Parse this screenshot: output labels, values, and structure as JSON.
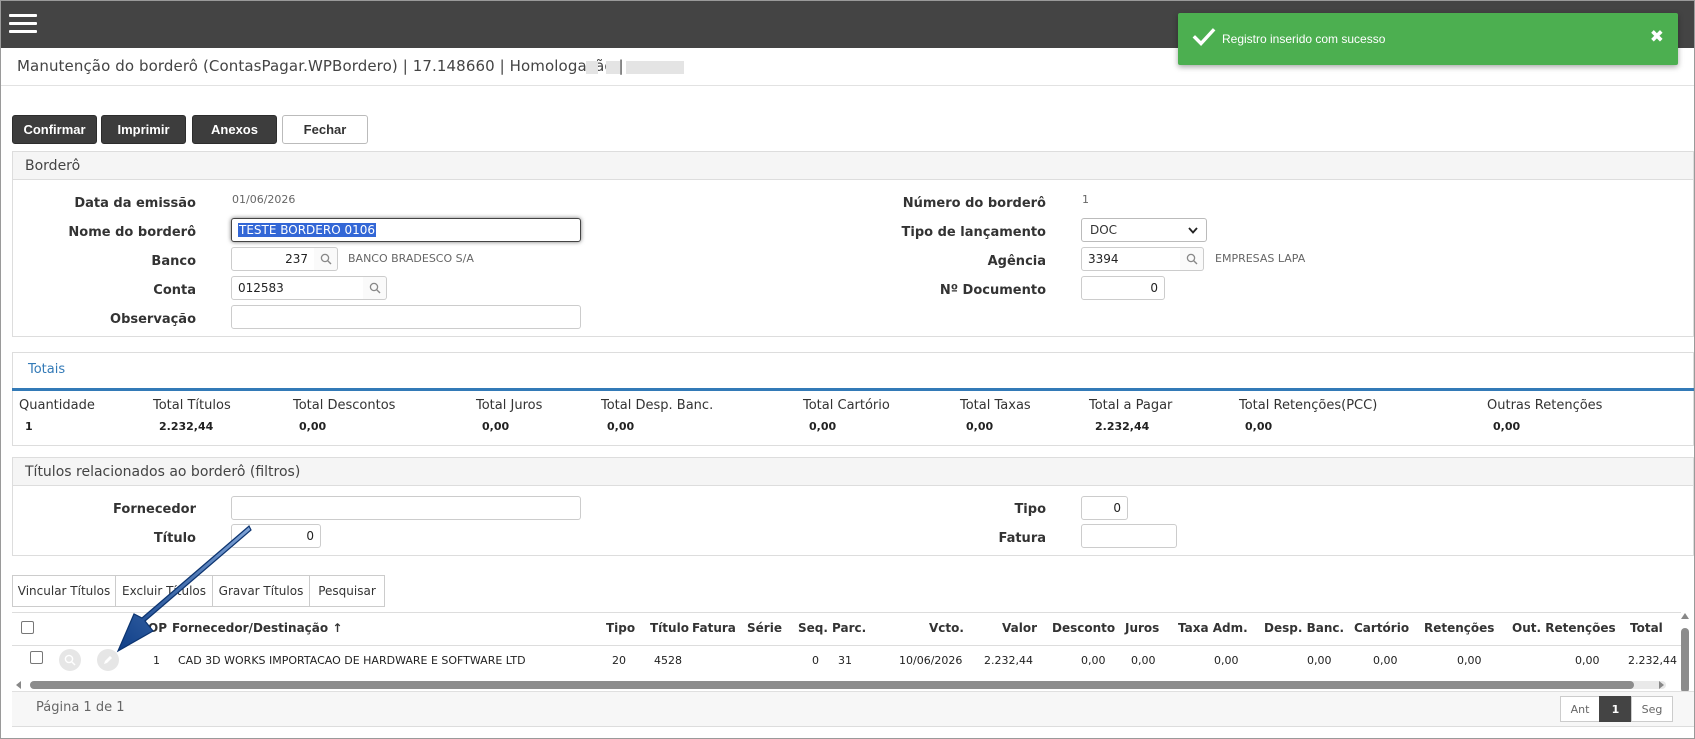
{
  "app": {
    "page_title": "Manutenção do borderô (ContasPagar.WPBordero) | 17.148660 | Homologação |"
  },
  "toast": {
    "message": "Registro inserido com sucesso",
    "color": "#4caf50",
    "icon": "check-icon",
    "close_icon": "close-icon"
  },
  "toolbar": {
    "confirm": "Confirmar",
    "print": "Imprimir",
    "attachments": "Anexos",
    "close": "Fechar"
  },
  "bordero": {
    "title": "Borderô",
    "emission_date_label": "Data da emissão",
    "emission_date": "01/06/2026",
    "name_label": "Nome do borderô",
    "name": "TESTE BORDERO 0106",
    "bank_label": "Banco",
    "bank_code": "237",
    "bank_name": "BANCO BRADESCO S/A",
    "account_label": "Conta",
    "account": "012583",
    "notes_label": "Observação",
    "notes": "",
    "number_label": "Número do borderô",
    "number": "1",
    "entry_type_label": "Tipo de lançamento",
    "entry_type": "DOC",
    "agency_label": "Agência",
    "agency": "3394",
    "agency_name": "EMPRESAS LAPA",
    "doc_number_label": "Nº Documento",
    "doc_number": "0"
  },
  "totals": {
    "tab": "Totais",
    "accent": "#337ab7",
    "columns": [
      {
        "label": "Quantidade",
        "value": "1"
      },
      {
        "label": "Total Títulos",
        "value": "2.232,44"
      },
      {
        "label": "Total Descontos",
        "value": "0,00"
      },
      {
        "label": "Total Juros",
        "value": "0,00"
      },
      {
        "label": "Total Desp. Banc.",
        "value": "0,00"
      },
      {
        "label": "Total Cartório",
        "value": "0,00"
      },
      {
        "label": "Total Taxas",
        "value": "0,00"
      },
      {
        "label": "Total a Pagar",
        "value": "2.232,44"
      },
      {
        "label": "Total Retenções(PCC)",
        "value": "0,00"
      },
      {
        "label": "Outras Retenções",
        "value": "0,00"
      }
    ]
  },
  "filters": {
    "title": "Títulos relacionados ao borderô (filtros)",
    "supplier_label": "Fornecedor",
    "supplier": "",
    "title_label": "Título",
    "title_value": "0",
    "type_label": "Tipo",
    "type_value": "0",
    "invoice_label": "Fatura",
    "invoice_value": ""
  },
  "actions": {
    "link": "Vincular Títulos",
    "remove": "Excluir Títulos",
    "save": "Gravar Títulos",
    "search": "Pesquisar"
  },
  "grid": {
    "headers": {
      "op": "OP",
      "supplier": "Fornecedor/Destinação",
      "sort_arrow": "↑",
      "type": "Tipo",
      "title": "Título",
      "invoice": "Fatura",
      "series": "Série",
      "seq": "Seq.",
      "parc": "Parc.",
      "due": "Vcto.",
      "value": "Valor",
      "discount": "Desconto",
      "interest": "Juros",
      "admin_fee": "Taxa Adm.",
      "bank_exp": "Desp. Banc.",
      "notary": "Cartório",
      "withholdings": "Retenções",
      "other_withholdings": "Out. Retenções",
      "total": "Total"
    },
    "rows": [
      {
        "op": "1",
        "supplier": "CAD 3D WORKS IMPORTACAO DE HARDWARE E SOFTWARE LTD",
        "type": "20",
        "title": "4528",
        "invoice": "",
        "series": "",
        "seq": "0",
        "parc": "31",
        "due": "10/06/2026",
        "value": "2.232,44",
        "discount": "0,00",
        "interest": "0,00",
        "admin_fee": "0,00",
        "bank_exp": "0,00",
        "notary": "0,00",
        "withholdings": "0,00",
        "other_withholdings": "0,00",
        "total": "2.232,44"
      }
    ]
  },
  "pagination": {
    "label": "Página 1 de 1",
    "prev": "Ant",
    "current": "1",
    "next": "Seg"
  }
}
